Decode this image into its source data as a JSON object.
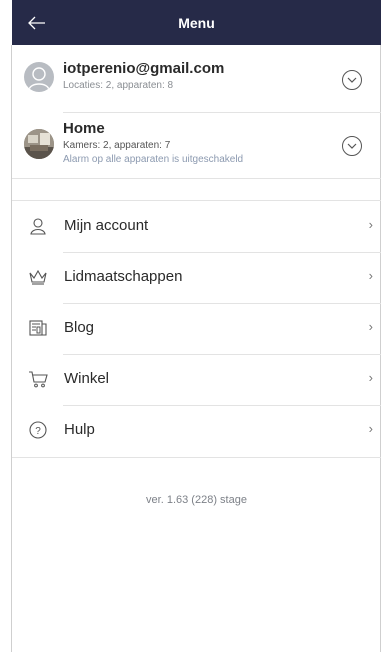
{
  "header": {
    "title": "Menu"
  },
  "accounts": [
    {
      "title": "iotperenio@gmail.com",
      "subtitle": "Locaties: 2, apparaten: 8"
    },
    {
      "title": "Home",
      "subtitle": "Kamers: 2, apparaten: 7",
      "status": "Alarm op alle apparaten is uitgeschakeld"
    }
  ],
  "menu": [
    {
      "label": "Mijn account",
      "icon": "person-icon"
    },
    {
      "label": "Lidmaatschappen",
      "icon": "crown-icon"
    },
    {
      "label": "Blog",
      "icon": "newspaper-icon"
    },
    {
      "label": "Winkel",
      "icon": "cart-icon"
    },
    {
      "label": "Hulp",
      "icon": "help-icon"
    }
  ],
  "version": "ver. 1.63 (228) stage",
  "colors": {
    "header_bg": "#262a48",
    "text": "#2a2a2a",
    "muted": "#8a8e93"
  }
}
